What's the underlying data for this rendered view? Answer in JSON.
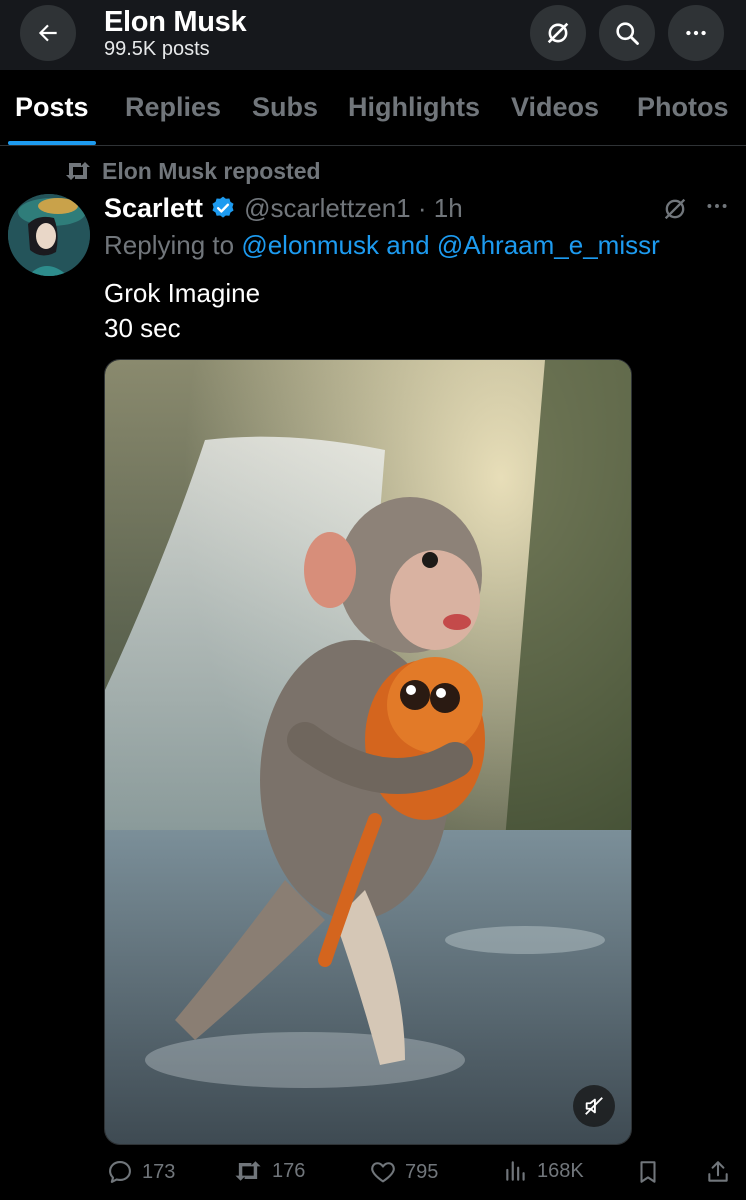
{
  "header": {
    "title": "Elon Musk",
    "post_count": "99.5K posts"
  },
  "tabs": [
    {
      "label": "Posts",
      "active": true
    },
    {
      "label": "Replies"
    },
    {
      "label": "Subs"
    },
    {
      "label": "Highlights"
    },
    {
      "label": "Videos"
    },
    {
      "label": "Photos"
    }
  ],
  "post": {
    "repost_label": "Elon Musk reposted",
    "author_name": "Scarlett",
    "handle_time": "@scarlettzen1 · 1h",
    "replying_prefix": "Replying to",
    "reply_mention_1": "@elonmusk",
    "reply_and": "and",
    "reply_mention_2": "@Ahraam_e_missr",
    "text_line_1": "Grok Imagine",
    "text_line_2": "30 sec",
    "media_description_icon": "video-muted-icon"
  },
  "actions": {
    "replies": "173",
    "reposts": "176",
    "likes": "795",
    "views": "168K"
  },
  "colors": {
    "accent": "#1d9bf0",
    "muted_text": "#71767b",
    "background": "#000000",
    "header_bg": "#16181c"
  }
}
